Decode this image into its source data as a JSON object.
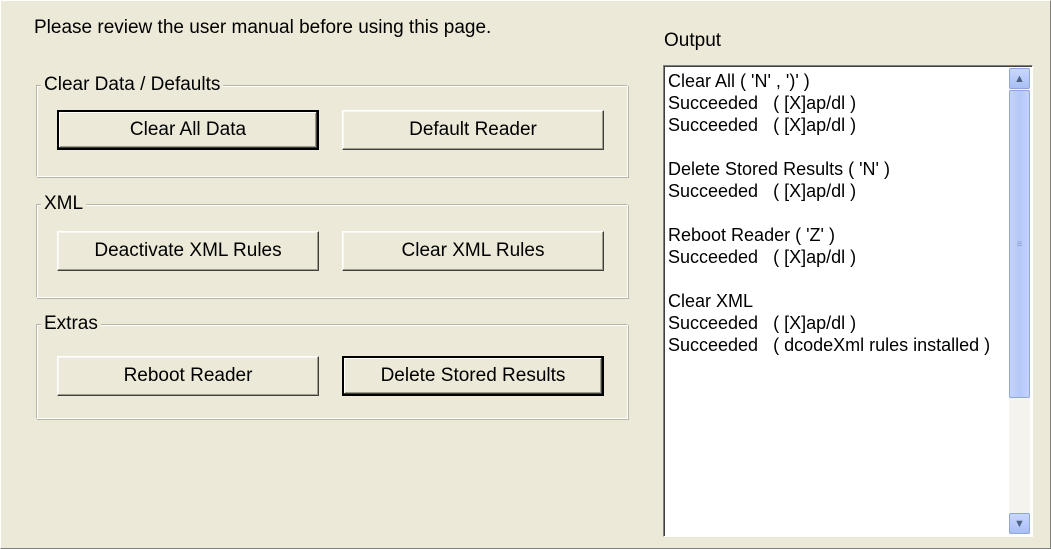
{
  "notice": "Please review the user manual before using this page.",
  "groups": {
    "clear": {
      "legend": "Clear Data / Defaults",
      "left_button": "Clear All Data",
      "right_button": "Default Reader"
    },
    "xml": {
      "legend": "XML",
      "left_button": "Deactivate XML Rules",
      "right_button": "Clear XML Rules"
    },
    "extras": {
      "legend": "Extras",
      "left_button": "Reboot Reader",
      "right_button": "Delete Stored Results"
    }
  },
  "output": {
    "label": "Output",
    "text": "Clear All ( 'N' , ')' )\nSucceeded   ( [X]ap/dl )\nSucceeded   ( [X]ap/dl )\n\nDelete Stored Results ( 'N' )\nSucceeded   ( [X]ap/dl )\n\nReboot Reader ( 'Z' )\nSucceeded   ( [X]ap/dl )\n\nClear XML\nSucceeded   ( [X]ap/dl )\nSucceeded   ( dcodeXml rules installed )"
  },
  "icons": {
    "scroll_up": "chevron-up-icon",
    "scroll_down": "chevron-down-icon"
  }
}
